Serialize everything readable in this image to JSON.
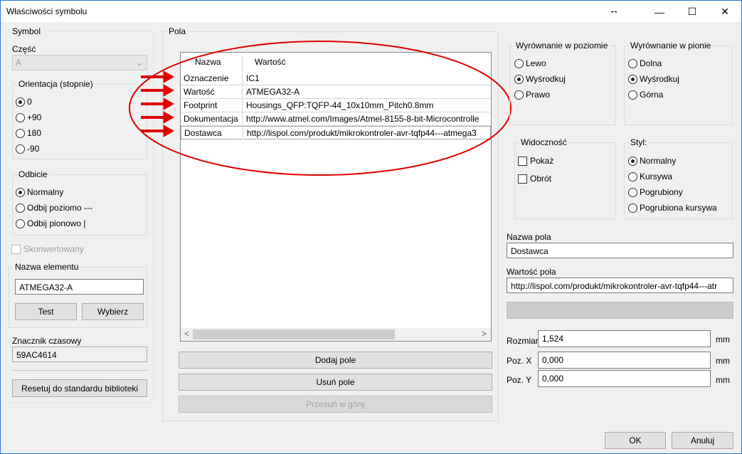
{
  "window": {
    "title": "Właściwości symbolu",
    "resize_icon": "↔",
    "minimize": "—",
    "maximize": "☐",
    "close": "✕"
  },
  "symbol": {
    "title": "Symbol",
    "part_label": "Część",
    "part_value": "A",
    "orientation": {
      "title": "Orientacja (stopnie)",
      "options": [
        "0",
        "+90",
        "180",
        "-90"
      ],
      "selected": "0"
    },
    "mirror": {
      "title": "Odbicie",
      "options": [
        "Normalny",
        "Odbij poziomo ---",
        "Odbij pionowo |"
      ],
      "selected": "Normalny"
    },
    "converted_label": "Skonwertowany",
    "element_name": {
      "title": "Nazwa elementu",
      "value": "ATMEGA32-A",
      "test_button": "Test",
      "choose_button": "Wybierz"
    },
    "timestamp_label": "Znacznik czasowy",
    "timestamp_value": "59AC4614",
    "reset_button": "Resetuj do standardu biblioteki"
  },
  "fields": {
    "title": "Pola",
    "col_name": "Nazwa",
    "col_value": "Wartość",
    "rows": [
      {
        "name": "Oznaczenie",
        "value": "IC1"
      },
      {
        "name": "Wartość",
        "value": "ATMEGA32-A"
      },
      {
        "name": "Footprint",
        "value": "Housings_QFP:TQFP-44_10x10mm_Pitch0.8mm"
      },
      {
        "name": "Dokumentacja",
        "value": "http://www.atmel.com/Images/Atmel-8155-8-bit-Microcontrolle"
      },
      {
        "name": "Dostawca",
        "value": "http://lispol.com/produkt/mikrokontroler-avr-tqfp44---atmega3"
      }
    ],
    "scroll_left": "<",
    "scroll_right": ">",
    "add_button": "Dodaj pole",
    "remove_button": "Usuń pole",
    "move_up_button": "Przesuń w górę"
  },
  "horizontal_align": {
    "title": "Wyrównanie w poziomie",
    "options": [
      "Lewo",
      "Wyśrodkuj",
      "Prawo"
    ],
    "selected": "Wyśrodkuj"
  },
  "vertical_align": {
    "title": "Wyrównanie w pionie",
    "options": [
      "Dolna",
      "Wyśrodkuj",
      "Górna"
    ],
    "selected": "Wyśrodkuj"
  },
  "visibility": {
    "title": "Widoczność",
    "show_label": "Pokaż",
    "rotate_label": "Obrót"
  },
  "style": {
    "title": "Styl:",
    "options": [
      "Normalny",
      "Kursywa",
      "Pogrubiony",
      "Pogrubiona kursywa"
    ],
    "selected": "Normalny"
  },
  "field_name": {
    "label": "Nazwa pola",
    "value": "Dostawca"
  },
  "field_value": {
    "label": "Wartość pola",
    "value": "http://lispol.com/produkt/mikrokontroler-avr-tqfp44---atr"
  },
  "size": {
    "label": "Rozmiar",
    "value": "1,524",
    "unit": "mm"
  },
  "pos_x": {
    "label": "Poz. X",
    "value": "0,000",
    "unit": "mm"
  },
  "pos_y": {
    "label": "Poz. Y",
    "value": "0,000",
    "unit": "mm"
  },
  "dialog": {
    "ok_button": "OK",
    "cancel_button": "Anuluj"
  },
  "colors": {
    "annotation": "#e00000",
    "accent": "#2b78d7"
  }
}
